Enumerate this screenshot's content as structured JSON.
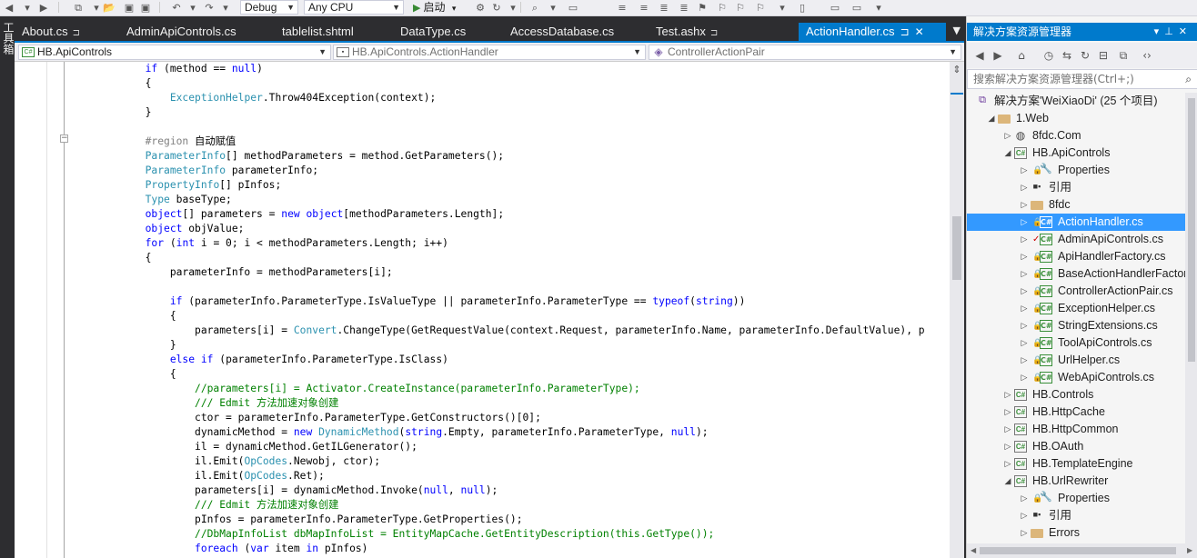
{
  "toolbar": {
    "config": "Debug",
    "platform": "Any CPU",
    "start_label": "启动"
  },
  "left_strip": {
    "label": "工具箱"
  },
  "tabs": [
    {
      "label": "About.cs",
      "pinned": true
    },
    {
      "label": "AdminApiControls.cs"
    },
    {
      "label": "tablelist.shtml"
    },
    {
      "label": "DataType.cs"
    },
    {
      "label": "AccessDatabase.cs"
    },
    {
      "label": "Test.ashx",
      "pinned": true
    },
    {
      "label": "ActionHandler.cs",
      "pinned": true,
      "active": true
    }
  ],
  "nav": {
    "project": "HB.ApiControls",
    "class": "HB.ApiControls.ActionHandler",
    "member": "ControllerActionPair"
  },
  "code_lines": [
    "            if (method == null)",
    "            {",
    "                ExceptionHelper.Throw404Exception(context);",
    "            }",
    "",
    "            #region 自动赋值",
    "            ParameterInfo[] methodParameters = method.GetParameters();",
    "            ParameterInfo parameterInfo;",
    "            PropertyInfo[] pInfos;",
    "            Type baseType;",
    "            object[] parameters = new object[methodParameters.Length];",
    "            object objValue;",
    "            for (int i = 0; i < methodParameters.Length; i++)",
    "            {",
    "                parameterInfo = methodParameters[i];",
    "",
    "                if (parameterInfo.ParameterType.IsValueType || parameterInfo.ParameterType == typeof(string))",
    "                {",
    "                    parameters[i] = Convert.ChangeType(GetRequestValue(context.Request, parameterInfo.Name, parameterInfo.DefaultValue), p",
    "                }",
    "                else if (parameterInfo.ParameterType.IsClass)",
    "                {",
    "                    //parameters[i] = Activator.CreateInstance(parameterInfo.ParameterType);",
    "                    /// Edmit 方法加速对象创建",
    "                    ctor = parameterInfo.ParameterType.GetConstructors()[0];",
    "                    dynamicMethod = new DynamicMethod(string.Empty, parameterInfo.ParameterType, null);",
    "                    il = dynamicMethod.GetILGenerator();",
    "                    il.Emit(OpCodes.Newobj, ctor);",
    "                    il.Emit(OpCodes.Ret);",
    "                    parameters[i] = dynamicMethod.Invoke(null, null);",
    "                    /// Edmit 方法加速对象创建",
    "                    pInfos = parameterInfo.ParameterType.GetProperties();",
    "                    //DbMapInfoList dbMapInfoList = EntityMapCache.GetEntityDescription(this.GetType());",
    "                    foreach (var item in pInfos)"
  ],
  "solution": {
    "title": "解决方案资源管理器",
    "search_placeholder": "搜索解决方案资源管理器(Ctrl+;)",
    "nodes": [
      {
        "label": "解决方案'WeiXiaoDi' (25 个项目)",
        "level": 0,
        "icon": "sln",
        "expander": ""
      },
      {
        "label": "1.Web",
        "level": 1,
        "icon": "folder",
        "expander": "down"
      },
      {
        "label": "8fdc.Com",
        "level": 2,
        "icon": "globe",
        "expander": "right"
      },
      {
        "label": "HB.ApiControls",
        "level": 2,
        "icon": "proj",
        "expander": "down"
      },
      {
        "label": "Properties",
        "level": 3,
        "icon": "wrench",
        "expander": "right"
      },
      {
        "label": "引用",
        "level": 3,
        "icon": "ref",
        "expander": "right"
      },
      {
        "label": "8fdc",
        "level": 3,
        "icon": "folder",
        "expander": "right"
      },
      {
        "label": "ActionHandler.cs",
        "level": 3,
        "icon": "cs",
        "expander": "right",
        "selected": true
      },
      {
        "label": "AdminApiControls.cs",
        "level": 3,
        "icon": "cs",
        "expander": "right",
        "checked": true
      },
      {
        "label": "ApiHandlerFactory.cs",
        "level": 3,
        "icon": "cs",
        "expander": "right"
      },
      {
        "label": "BaseActionHandlerFactory",
        "level": 3,
        "icon": "cs",
        "expander": "right"
      },
      {
        "label": "ControllerActionPair.cs",
        "level": 3,
        "icon": "cs",
        "expander": "right"
      },
      {
        "label": "ExceptionHelper.cs",
        "level": 3,
        "icon": "cs",
        "expander": "right"
      },
      {
        "label": "StringExtensions.cs",
        "level": 3,
        "icon": "cs",
        "expander": "right"
      },
      {
        "label": "ToolApiControls.cs",
        "level": 3,
        "icon": "cs",
        "expander": "right"
      },
      {
        "label": "UrlHelper.cs",
        "level": 3,
        "icon": "cs",
        "expander": "right"
      },
      {
        "label": "WebApiControls.cs",
        "level": 3,
        "icon": "cs",
        "expander": "right"
      },
      {
        "label": "HB.Controls",
        "level": 2,
        "icon": "proj",
        "expander": "right"
      },
      {
        "label": "HB.HttpCache",
        "level": 2,
        "icon": "proj",
        "expander": "right"
      },
      {
        "label": "HB.HttpCommon",
        "level": 2,
        "icon": "proj",
        "expander": "right"
      },
      {
        "label": "HB.OAuth",
        "level": 2,
        "icon": "proj",
        "expander": "right"
      },
      {
        "label": "HB.TemplateEngine",
        "level": 2,
        "icon": "proj",
        "expander": "right"
      },
      {
        "label": "HB.UrlRewriter",
        "level": 2,
        "icon": "proj",
        "expander": "down"
      },
      {
        "label": "Properties",
        "level": 3,
        "icon": "wrench",
        "expander": "right"
      },
      {
        "label": "引用",
        "level": 3,
        "icon": "ref",
        "expander": "right"
      },
      {
        "label": "Errors",
        "level": 3,
        "icon": "folder",
        "expander": "right"
      }
    ]
  },
  "colors": {
    "accent": "#007acc",
    "selection": "#3399ff",
    "keyword": "#0000ff",
    "type": "#2b91af",
    "comment": "#008000"
  }
}
